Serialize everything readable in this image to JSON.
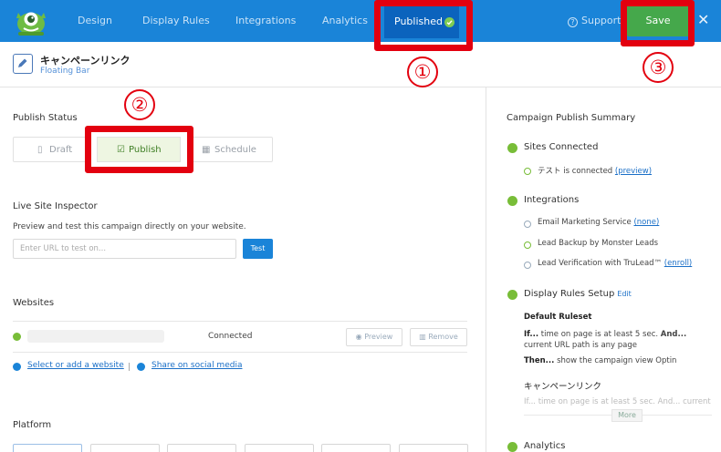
{
  "header": {
    "nav": [
      "Design",
      "Display Rules",
      "Integrations",
      "Analytics"
    ],
    "published_label": "Published",
    "support_label": "Support",
    "save_label": "Save",
    "close_glyph": "✕",
    "accent_color": "#1a84d8",
    "save_color": "#45a84b"
  },
  "annotations": [
    "①",
    "②",
    "③"
  ],
  "campaign": {
    "title": "キャンペーンリンク",
    "subtitle": "Floating Bar"
  },
  "publish_status": {
    "title": "Publish Status",
    "options": [
      "Draft",
      "Publish",
      "Schedule"
    ],
    "selected": "Publish"
  },
  "inspector": {
    "title": "Live Site Inspector",
    "description": "Preview and test this campaign directly on your website.",
    "placeholder": "Enter URL to test on...",
    "test_label": "Test"
  },
  "websites": {
    "title": "Websites",
    "status": "Connected",
    "preview_label": "Preview",
    "remove_label": "Remove",
    "select_link": "Select or add a website",
    "share_link": "Share on social media"
  },
  "platform": {
    "title": "Platform"
  },
  "summary": {
    "title": "Campaign Publish Summary",
    "sites": {
      "heading": "Sites Connected",
      "item_prefix": "テスト is connected",
      "item_link": "(preview)"
    },
    "integrations": {
      "heading": "Integrations",
      "items": [
        {
          "text": "Email Marketing Service",
          "link": "(none)"
        },
        {
          "text": "Lead Backup by Monster Leads",
          "link": ""
        },
        {
          "text": "Lead Verification with TruLead™",
          "link": "(enroll)"
        }
      ]
    },
    "rules": {
      "heading": "Display Rules Setup",
      "edit": "Edit",
      "ruleset1": "Default Ruleset",
      "if_label": "If...",
      "if_text": "time on page is at least 5 sec.",
      "and_label": "And...",
      "and_text": "current URL path is any page",
      "then_label": "Then...",
      "then_text": "show the campaign view Optin",
      "ruleset2": "キャンペーンリンク",
      "faded_text": "If... time on page is at least 5 sec. And... current",
      "more_label": "More"
    },
    "analytics": {
      "heading": "Analytics"
    }
  }
}
